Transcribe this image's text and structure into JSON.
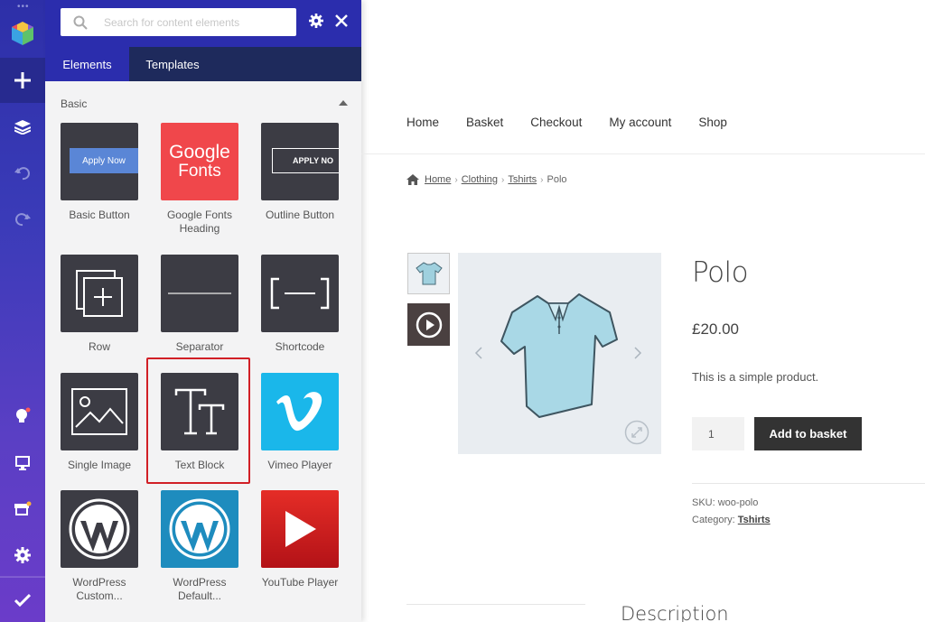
{
  "toolbar": {
    "icons": [
      "logo-cubes-icon",
      "plus-icon",
      "layers-icon",
      "undo-icon",
      "redo-icon",
      "lightbulb-icon",
      "desktop-icon",
      "store-icon",
      "gear-icon",
      "check-icon"
    ]
  },
  "panel": {
    "search": {
      "placeholder": "Search for content elements",
      "value": ""
    },
    "tabs": [
      {
        "label": "Elements",
        "active": true
      },
      {
        "label": "Templates",
        "active": false
      }
    ],
    "section": {
      "label": "Basic",
      "expanded": true
    },
    "tiles": [
      {
        "label": "Basic Button",
        "thumb_text": "Apply Now"
      },
      {
        "label": "Google Fonts Heading",
        "thumb_text_1": "Google",
        "thumb_text_2": "Fonts"
      },
      {
        "label": "Outline Button",
        "thumb_text": "APPLY NO"
      },
      {
        "label": "Row"
      },
      {
        "label": "Separator"
      },
      {
        "label": "Shortcode"
      },
      {
        "label": "Single Image"
      },
      {
        "label": "Text Block",
        "highlighted": true
      },
      {
        "label": "Vimeo Player"
      },
      {
        "label": "WordPress Custom..."
      },
      {
        "label": "WordPress Default..."
      },
      {
        "label": "YouTube Player"
      }
    ],
    "colors": {
      "panel_bg": "#f3f3f4",
      "tile_dark": "#3c3c44",
      "google_red": "#f0474b",
      "vimeo_blue": "#1ab7ea",
      "wp_blue": "#1e8cbe",
      "youtube_red": "#e52d27",
      "highlight": "#d11f26",
      "accent": "#2b2dad"
    }
  },
  "site": {
    "nav": [
      "Home",
      "Basket",
      "Checkout",
      "My account",
      "Shop"
    ],
    "breadcrumb": {
      "home": "Home",
      "clothing": "Clothing",
      "tshirts": "Tshirts",
      "current": "Polo"
    },
    "product": {
      "title": "Polo",
      "price": "£20.00",
      "description": "This is a simple product.",
      "quantity": "1",
      "add_label": "Add to basket",
      "sku_label": "SKU: woo-polo",
      "category_label": "Category:",
      "category_value": "Tshirts"
    },
    "description_heading": "Description"
  }
}
